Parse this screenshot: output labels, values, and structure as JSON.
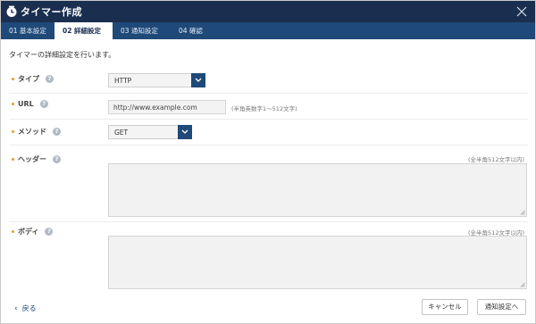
{
  "window": {
    "title": "タイマー作成"
  },
  "tabs": [
    {
      "label": "01 基本設定"
    },
    {
      "label": "02 詳細設定"
    },
    {
      "label": "03 通知設定"
    },
    {
      "label": "04 確認"
    }
  ],
  "intro": "タイマーの詳細設定を行います。",
  "fields": {
    "type": {
      "label": "タイプ",
      "value": "HTTP"
    },
    "url": {
      "label": "URL",
      "value": "http://www.example.com",
      "hint": "(半角英数字1～512文字)"
    },
    "method": {
      "label": "メソッド",
      "value": "GET"
    },
    "header": {
      "label": "ヘッダー",
      "hint": "(全半角512文字以内)"
    },
    "body": {
      "label": "ボディ",
      "hint": "(全半角512文字以内)"
    }
  },
  "help_glyph": "?",
  "footer": {
    "back_label": "戻る",
    "cancel_label": "キャンセル",
    "next_label": "通知設定へ"
  },
  "colors": {
    "titlebar": "#1a2f4f",
    "tabbar": "#1f4978",
    "bullet": "#e59b2a",
    "help": "#b3b9c4"
  },
  "icons": {
    "title": "clock-icon",
    "close": "close-icon",
    "select_arrow": "chevron-down-icon",
    "help": "help-icon",
    "back": "chevron-left-icon"
  }
}
